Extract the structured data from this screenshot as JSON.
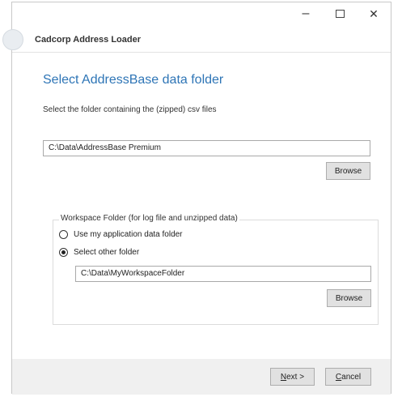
{
  "window": {
    "app_title": "Cadcorp Address Loader",
    "controls": {
      "minimize": "–",
      "close": "✕"
    }
  },
  "page": {
    "heading": "Select AddressBase data folder",
    "subtitle": "Select the folder containing the (zipped) csv files"
  },
  "source": {
    "path_value": "C:\\Data\\AddressBase Premium",
    "browse_label": "Browse"
  },
  "workspace": {
    "group_label": "Workspace Folder (for log file and unzipped data)",
    "options": [
      {
        "label": "Use my application data folder",
        "selected": false
      },
      {
        "label": "Select other folder",
        "selected": true
      }
    ],
    "path_value": "C:\\Data\\MyWorkspaceFolder",
    "browse_label": "Browse"
  },
  "footer": {
    "next_mnemonic": "N",
    "next_rest": "ext >",
    "cancel_mnemonic": "C",
    "cancel_rest": "ancel"
  },
  "colors": {
    "heading": "#2e75b6",
    "footer_bg": "#f0f0f0",
    "button_bg": "#e1e1e1"
  }
}
